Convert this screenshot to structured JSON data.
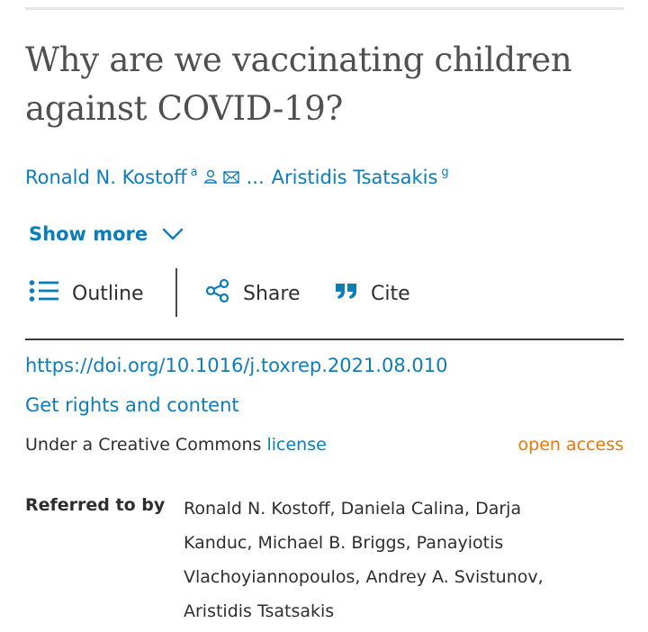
{
  "article": {
    "title": "Why are we vaccinating children against COVID-19?",
    "authors": {
      "first_author": "Ronald N. Kostoff",
      "first_affiliation": "a",
      "separator": "...",
      "last_author": "Aristidis Tsatsakis",
      "last_affiliation": "g"
    },
    "show_more_label": "Show more",
    "doi": "https://doi.org/10.1016/j.toxrep.2021.08.010",
    "rights_label": "Get rights and content",
    "license_prefix": "Under a Creative Commons",
    "license_link": "license",
    "access_badge": "open access"
  },
  "toolbar": {
    "outline_label": "Outline",
    "share_label": "Share",
    "cite_label": "Cite"
  },
  "referred_by": {
    "label": "Referred to by",
    "names": "Ronald N. Kostoff, Daniela Calina, Darja Kanduc, Michael B. Briggs, Panayiotis Vlachoyiannopoulos, Andrey A. Svistunov, Aristidis Tsatsakis"
  },
  "icons": {
    "author": "person-icon",
    "email": "envelope-icon",
    "chevron": "chevron-down-icon",
    "outline": "list-icon",
    "share": "share-icon",
    "cite": "quote-icon"
  },
  "colors": {
    "link": "#0c7dbb",
    "open_access": "#e6770b",
    "text": "#2e2e2e",
    "title": "#505050"
  }
}
